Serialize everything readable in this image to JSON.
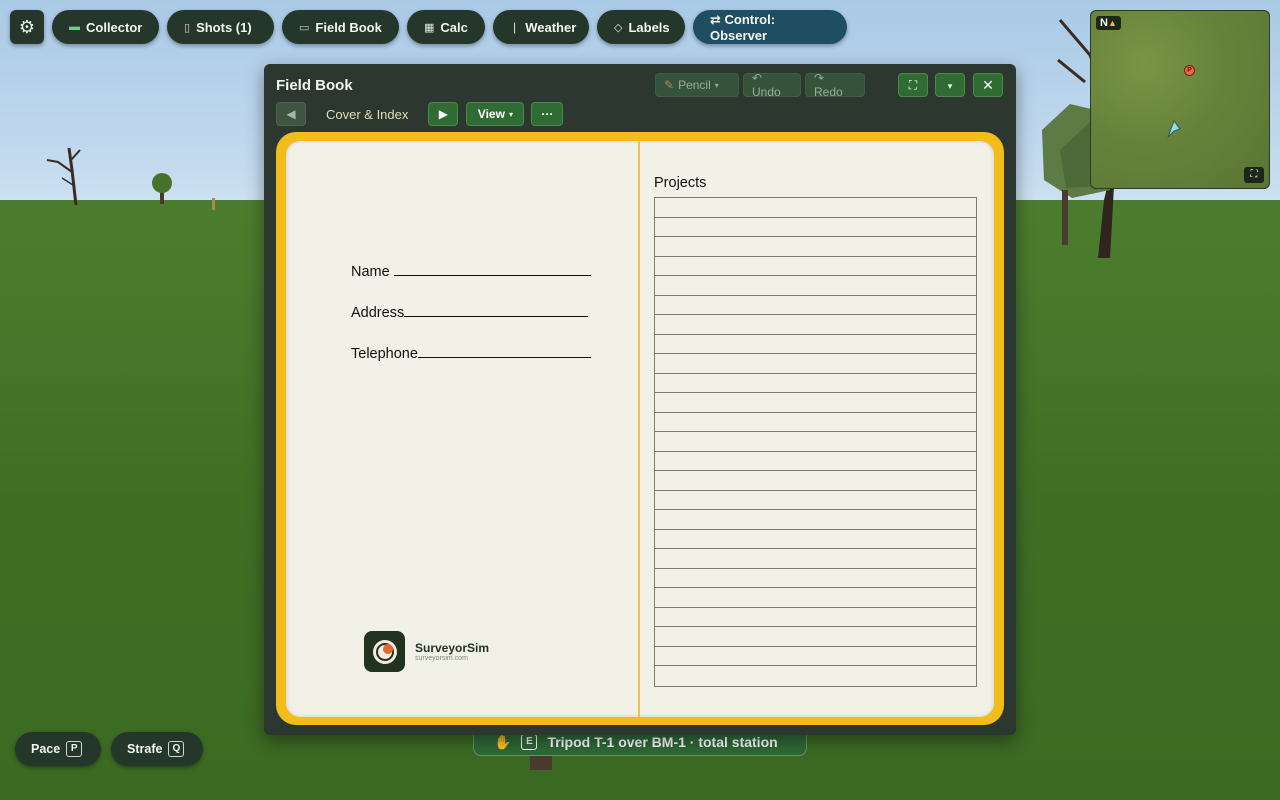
{
  "toolbar": {
    "settings_icon": "gear-icon",
    "buttons": {
      "collector": "Collector",
      "shots": "Shots (1)",
      "field_book": "Field Book",
      "calc": "Calc",
      "weather": "Weather",
      "labels": "Labels",
      "control": "⇄ Control: Observer"
    }
  },
  "minimap": {
    "north_label": "N",
    "poi_label": "P"
  },
  "field_book": {
    "title": "Field Book",
    "tools": {
      "pencil": "Pencil",
      "undo": "↶ Undo",
      "redo": "↷ Redo"
    },
    "page_label": "Cover & Index",
    "view_label": "View",
    "more_label": "···",
    "cover": {
      "name_label": "Name",
      "address_label": "Address",
      "telephone_label": "Telephone",
      "logo_name": "SurveyorSim",
      "logo_url": "surveyorsim.com"
    },
    "index": {
      "title": "Projects",
      "row_count": 25
    }
  },
  "bottom": {
    "pace_label": "Pace",
    "pace_key": "P",
    "strafe_label": "Strafe",
    "strafe_key": "Q"
  },
  "prompt": {
    "key": "E",
    "text": "Tripod T-1 over BM-1 · total station"
  },
  "colors": {
    "panel": "#25362a",
    "observer": "#1f4e63",
    "book_frame": "#f2bc1b",
    "page": "#f1f1e8",
    "accent_green": "#2f6b33"
  }
}
